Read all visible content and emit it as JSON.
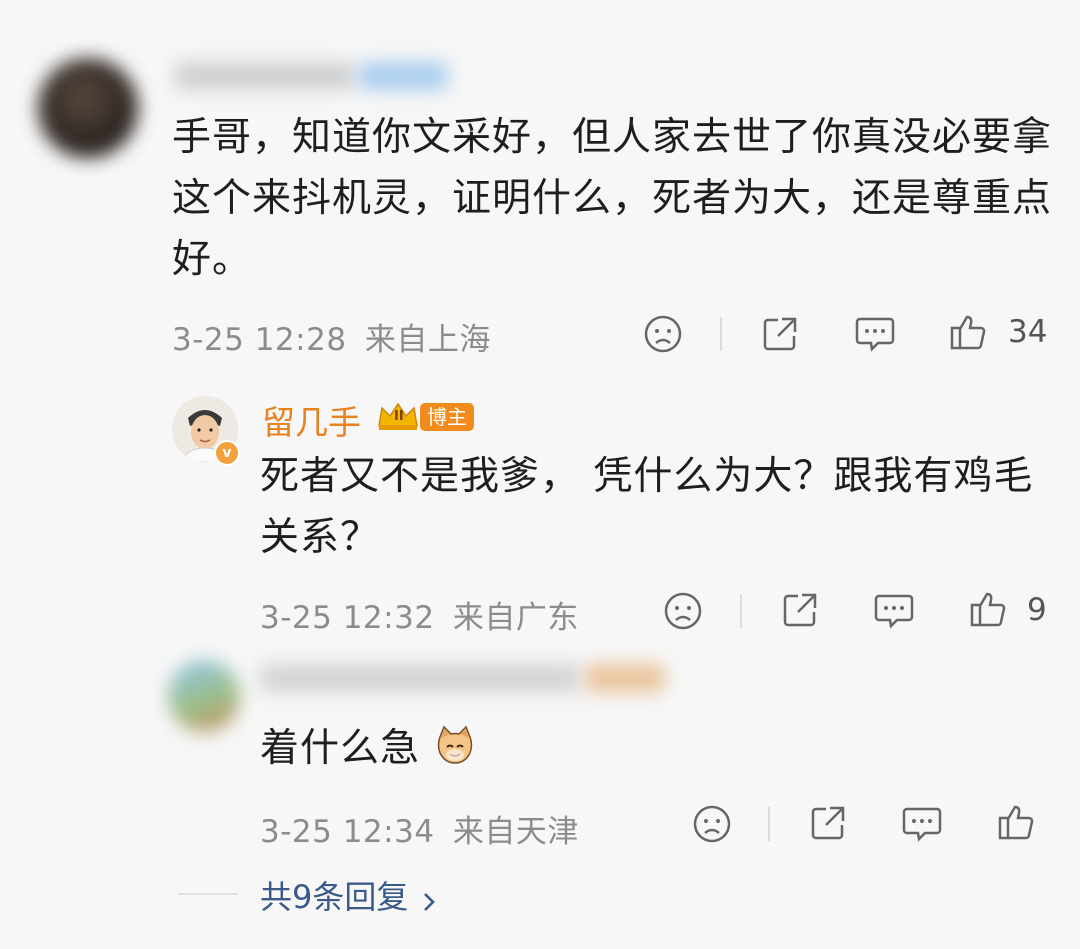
{
  "comments": [
    {
      "text": "手哥，知道你文采好，但人家去世了你真没必要拿这个来抖机灵，证明什么，死者为大，还是尊重点好。",
      "time": "3-25 12:28",
      "location": "来自上海",
      "likes": "34"
    },
    {
      "username": "留几手",
      "role_badge": "博主",
      "crown_level": "II",
      "verified_mark": "v",
      "text": "死者又不是我爹， 凭什么为大？跟我有鸡毛关系？",
      "time": "3-25 12:32",
      "location": "来自广东",
      "likes": "9"
    },
    {
      "text": "着什么急",
      "time": "3-25 12:34",
      "location": "来自天津",
      "likes": ""
    }
  ],
  "replies_link": "共9条回复",
  "icons": {
    "dislike": "sad-face-icon",
    "share": "share-icon",
    "comment": "comment-icon",
    "like": "thumbs-up-icon",
    "arrow": "chevron-right-icon",
    "cat": "cat-emoji-icon"
  },
  "colors": {
    "background": "#f7f7f7",
    "verified_name": "#e8821f",
    "link": "#3a5a8a",
    "meta": "#8c8c8c"
  }
}
